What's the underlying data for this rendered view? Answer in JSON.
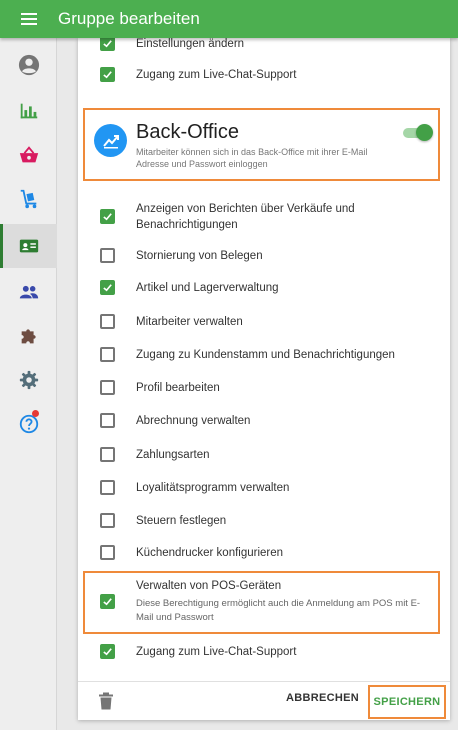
{
  "header": {
    "title": "Gruppe bearbeiten"
  },
  "sidebar": {
    "items": [
      {
        "icon": "account-circle-icon"
      },
      {
        "icon": "bar-chart-icon"
      },
      {
        "icon": "basket-icon"
      },
      {
        "icon": "dolly-icon"
      },
      {
        "icon": "id-card-icon",
        "active": true
      },
      {
        "icon": "people-icon"
      },
      {
        "icon": "puzzle-icon"
      },
      {
        "icon": "gear-icon"
      },
      {
        "icon": "help-icon",
        "badge": true
      }
    ]
  },
  "permissions_top": [
    {
      "label": "Einstellungen ändern",
      "checked": true
    },
    {
      "label": "Zugang zum Live-Chat-Support",
      "checked": true
    }
  ],
  "back_office": {
    "title": "Back-Office",
    "description": "Mitarbeiter können sich in das Back-Office mit ihrer E-Mail Adresse und Passwort einloggen",
    "enabled": true
  },
  "permissions": [
    {
      "label": "Anzeigen von Berichten über Verkäufe und Benachrichtigungen",
      "checked": true
    },
    {
      "label": "Stornierung von Belegen",
      "checked": false
    },
    {
      "label": "Artikel und Lagerverwaltung",
      "checked": true
    },
    {
      "label": "Mitarbeiter verwalten",
      "checked": false
    },
    {
      "label": "Zugang zu Kundenstamm und Benachrichtigungen",
      "checked": false
    },
    {
      "label": "Profil bearbeiten",
      "checked": false
    },
    {
      "label": "Abrechnung verwalten",
      "checked": false
    },
    {
      "label": "Zahlungsarten",
      "checked": false
    },
    {
      "label": "Loyalitätsprogramm verwalten",
      "checked": false
    },
    {
      "label": "Steuern festlegen",
      "checked": false
    },
    {
      "label": "Küchendrucker konfigurieren",
      "checked": false
    },
    {
      "label": "Verwalten von POS-Geräten",
      "description": "Diese Berechtigung ermöglicht auch die Anmeldung am POS mit E-Mail und Passwort",
      "checked": true
    },
    {
      "label": "Zugang zum Live-Chat-Support",
      "checked": true
    }
  ],
  "footer": {
    "cancel_label": "ABBRECHEN",
    "save_label": "SPEICHERN"
  },
  "colors": {
    "brand_green": "#4caf50",
    "checkbox_green": "#43a047",
    "highlight_orange": "#ef8a3a",
    "icon_blue": "#2196f3"
  }
}
